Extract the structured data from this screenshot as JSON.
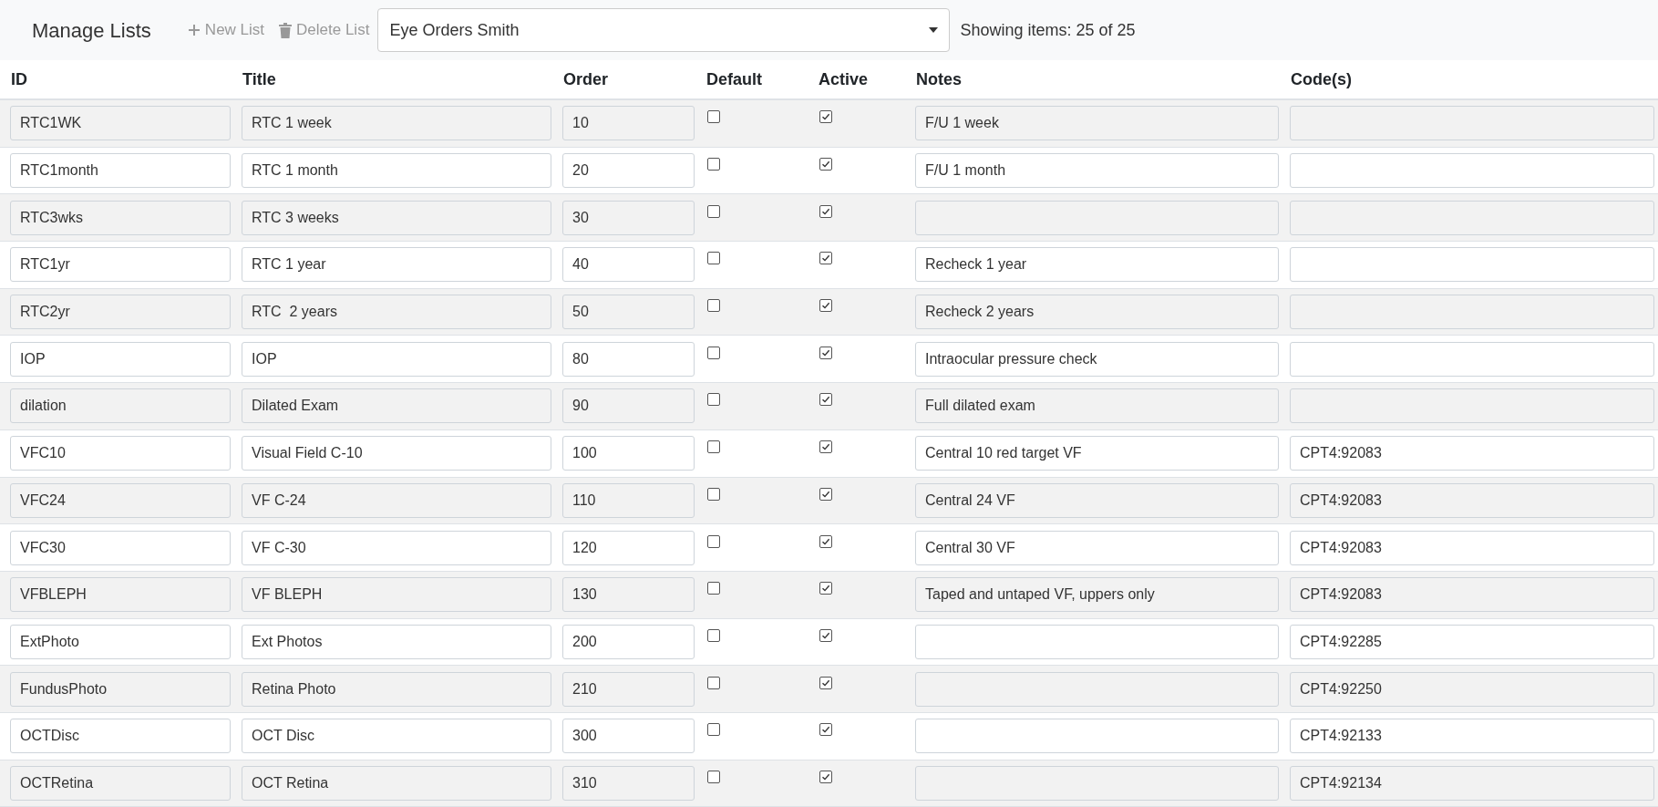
{
  "toolbar": {
    "title": "Manage Lists",
    "new_button": "New List",
    "delete_button": "Delete List",
    "list_select": {
      "value": "Eye Orders Smith"
    },
    "count": "Showing items: 25 of 25"
  },
  "table": {
    "columns": [
      "ID",
      "Title",
      "Order",
      "Default",
      "Active",
      "Notes",
      "Code(s)"
    ],
    "rows": [
      {
        "id": "RTC1WK",
        "title": "RTC 1 week",
        "order": "10",
        "default": false,
        "active": true,
        "notes": "F/U 1 week",
        "codes": ""
      },
      {
        "id": "RTC1month",
        "title": "RTC 1 month",
        "order": "20",
        "default": false,
        "active": true,
        "notes": "F/U 1 month",
        "codes": ""
      },
      {
        "id": "RTC3wks",
        "title": "RTC 3 weeks",
        "order": "30",
        "default": false,
        "active": true,
        "notes": "",
        "codes": ""
      },
      {
        "id": "RTC1yr",
        "title": "RTC 1 year",
        "order": "40",
        "default": false,
        "active": true,
        "notes": "Recheck 1 year",
        "codes": ""
      },
      {
        "id": "RTC2yr",
        "title": "RTC  2 years",
        "order": "50",
        "default": false,
        "active": true,
        "notes": "Recheck 2 years",
        "codes": ""
      },
      {
        "id": "IOP",
        "title": "IOP",
        "order": "80",
        "default": false,
        "active": true,
        "notes": "Intraocular pressure check",
        "codes": ""
      },
      {
        "id": "dilation",
        "title": "Dilated Exam",
        "order": "90",
        "default": false,
        "active": true,
        "notes": "Full dilated exam",
        "codes": ""
      },
      {
        "id": "VFC10",
        "title": "Visual Field C-10",
        "order": "100",
        "default": false,
        "active": true,
        "notes": "Central 10 red target VF",
        "codes": "CPT4:92083"
      },
      {
        "id": "VFC24",
        "title": "VF C-24",
        "order": "110",
        "default": false,
        "active": true,
        "notes": "Central 24 VF",
        "codes": "CPT4:92083"
      },
      {
        "id": "VFC30",
        "title": "VF C-30",
        "order": "120",
        "default": false,
        "active": true,
        "notes": "Central 30 VF",
        "codes": "CPT4:92083"
      },
      {
        "id": "VFBLEPH",
        "title": "VF BLEPH",
        "order": "130",
        "default": false,
        "active": true,
        "notes": "Taped and untaped VF, uppers only",
        "codes": "CPT4:92083"
      },
      {
        "id": "ExtPhoto",
        "title": "Ext Photos",
        "order": "200",
        "default": false,
        "active": true,
        "notes": "",
        "codes": "CPT4:92285"
      },
      {
        "id": "FundusPhoto",
        "title": "Retina Photo",
        "order": "210",
        "default": false,
        "active": true,
        "notes": "",
        "codes": "CPT4:92250"
      },
      {
        "id": "OCTDisc",
        "title": "OCT Disc",
        "order": "300",
        "default": false,
        "active": true,
        "notes": "",
        "codes": "CPT4:92133"
      },
      {
        "id": "OCTRetina",
        "title": "OCT Retina",
        "order": "310",
        "default": false,
        "active": true,
        "notes": "",
        "codes": "CPT4:92134"
      }
    ]
  }
}
